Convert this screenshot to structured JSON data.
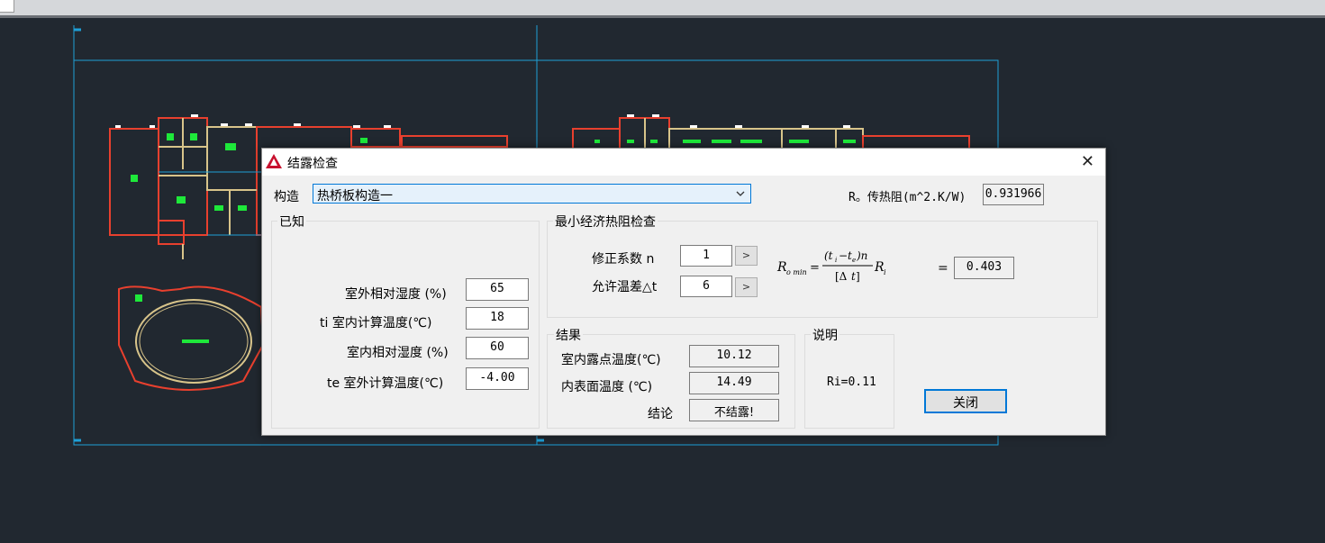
{
  "dialog": {
    "title": "结露检查",
    "structure_label": "构造",
    "structure_value": "热桥板构造一",
    "r0_label": "R。传热阻(m^2.K/W)",
    "r0_value": "0.931966",
    "close_button": "关闭"
  },
  "known": {
    "title": "已知",
    "outdoor_rh_label": "室外相对湿度 (%)",
    "outdoor_rh_value": "65",
    "ti_label": "ti 室内计算温度(℃)",
    "ti_value": "18",
    "indoor_rh_label": "室内相对湿度 (%)",
    "indoor_rh_value": "60",
    "te_label": "te 室外计算温度(℃)",
    "te_value": "-4.00"
  },
  "min_check": {
    "title": "最小经济热阻检查",
    "n_label": "修正系数  n",
    "n_value": "1",
    "dt_label": "允许温差△t",
    "dt_value": "6",
    "equals": "=",
    "result_value": "0.403"
  },
  "results": {
    "title": "结果",
    "dew_label": "室内露点温度(℃)",
    "dew_value": "10.12",
    "surface_label": "内表面温度  (℃)",
    "surface_value": "14.49",
    "conclusion_label": "结论",
    "conclusion_value": "不结露!"
  },
  "notes": {
    "title": "说明",
    "ri_text": "Ri=0.11"
  },
  "colors": {
    "cad_background": "#212830",
    "viewport_frame": "#1e9fd6",
    "wall_red": "#e8402e",
    "wall_tan": "#d8c48a",
    "room_label_green": "#1ee83a",
    "dialog_accent": "#0078d7"
  }
}
